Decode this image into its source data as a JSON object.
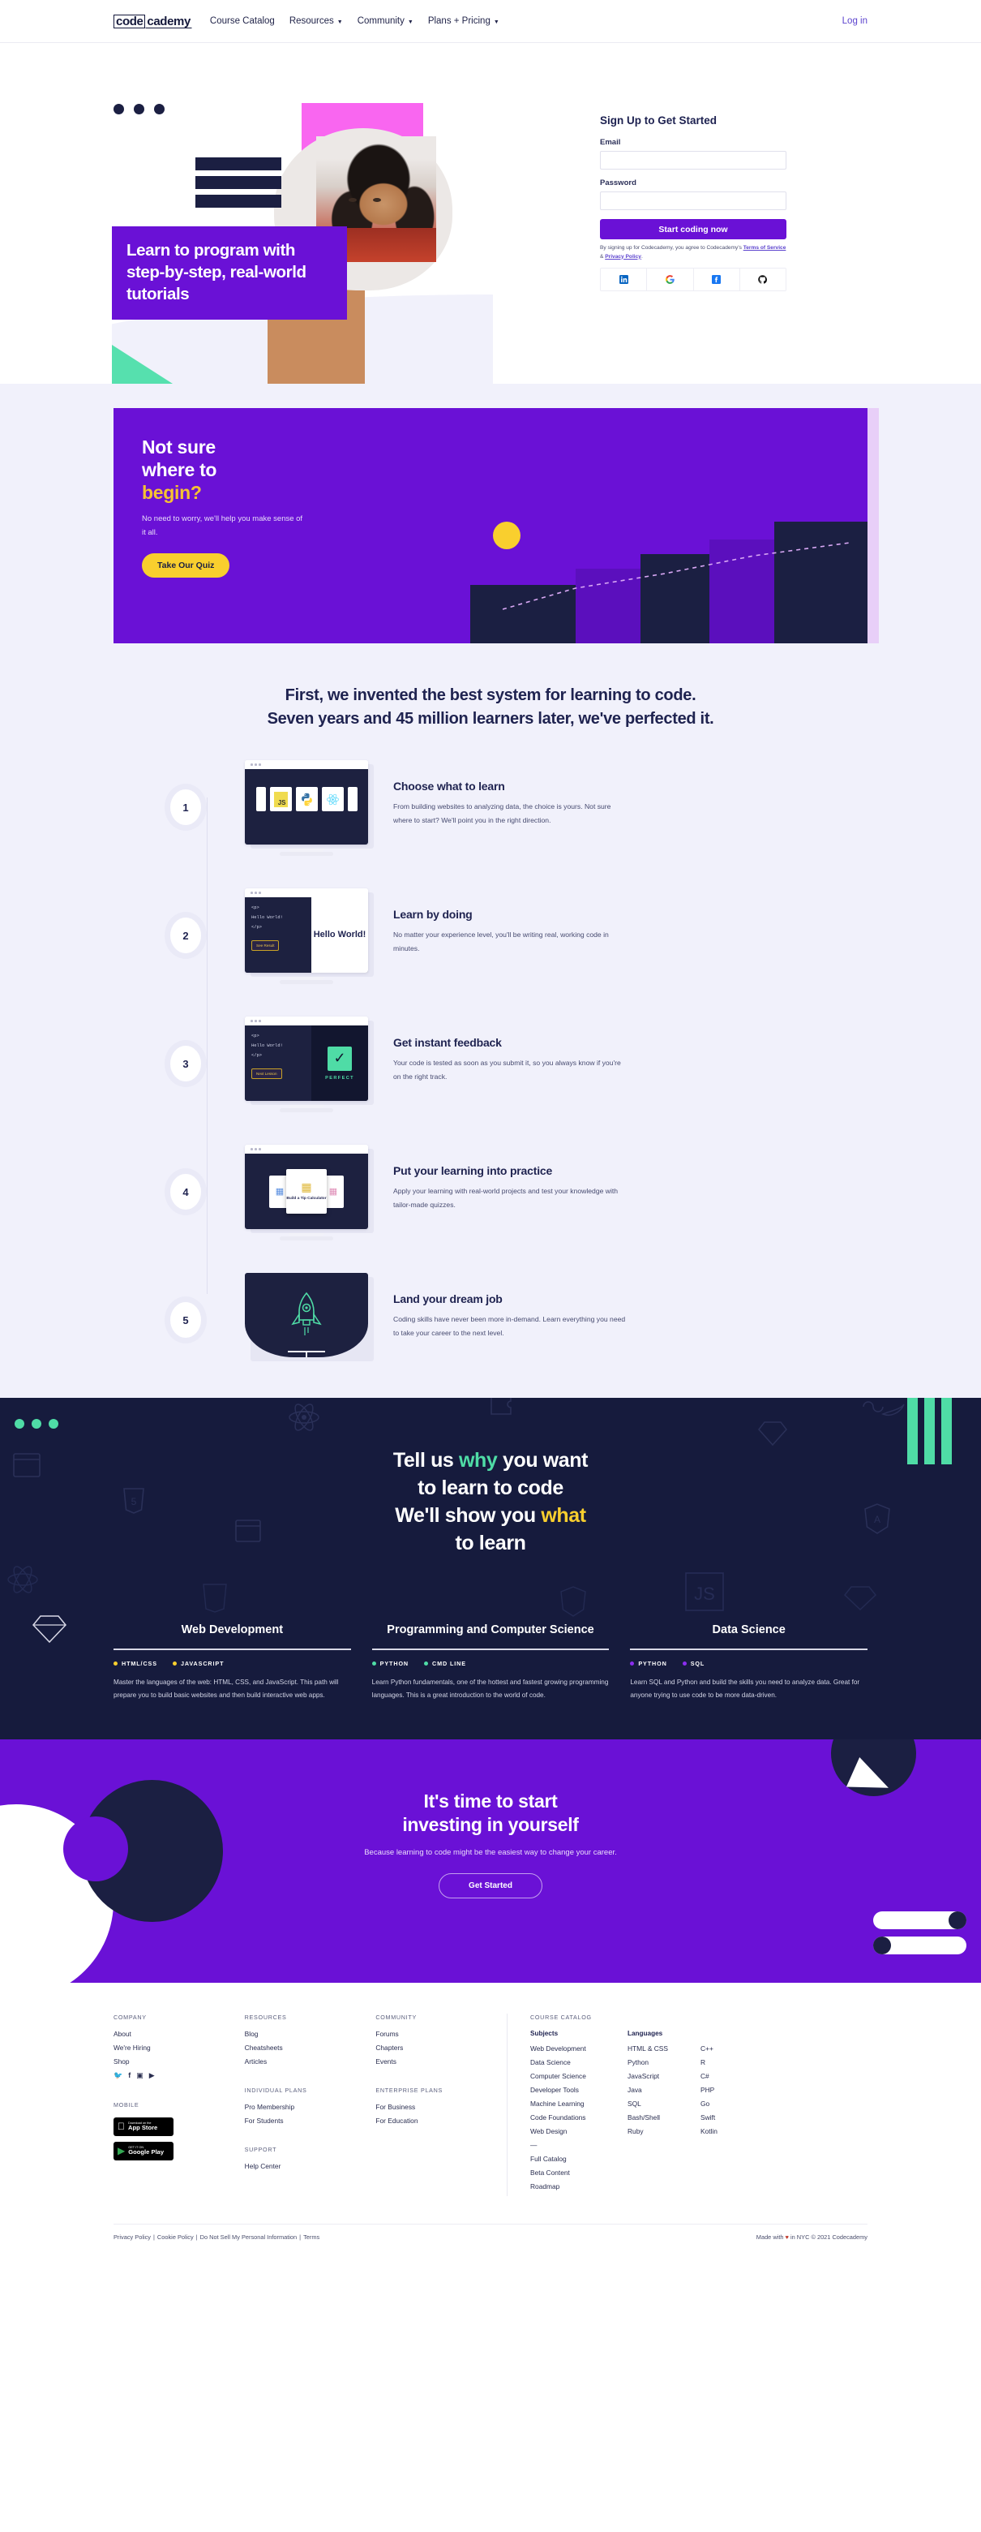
{
  "nav": {
    "logo_part1": "code",
    "logo_part2": "cademy",
    "links": [
      {
        "label": "Course Catalog",
        "caret": false
      },
      {
        "label": "Resources",
        "caret": true
      },
      {
        "label": "Community",
        "caret": true
      },
      {
        "label": "Plans + Pricing",
        "caret": true
      }
    ],
    "login": "Log in"
  },
  "hero": {
    "headline": "Learn to program with step-by-step, real-world tutorials",
    "signup": {
      "title": "Sign Up to Get Started",
      "email_label": "Email",
      "email_value": "",
      "email_placeholder": "",
      "password_label": "Password",
      "password_value": "",
      "password_placeholder": "",
      "submit": "Start coding now",
      "legal_prefix": "By signing up for Codecademy, you agree to Codecademy's ",
      "legal_terms": "Terms of Service",
      "legal_amp": " & ",
      "legal_privacy": "Privacy Policy",
      "legal_suffix": ".",
      "socials": [
        "linkedin-icon",
        "google-icon",
        "facebook-icon",
        "github-icon"
      ]
    }
  },
  "quiz": {
    "line1": "Not sure",
    "line2": "where to",
    "line3": "begin?",
    "sub": "No need to worry, we'll help you make sense of it all.",
    "button": "Take Our Quiz"
  },
  "steps_section": {
    "heading_line1": "First, we invented the best system for learning to code.",
    "heading_line2": "Seven years and 45 million learners later, we've perfected it.",
    "steps": [
      {
        "number": "1",
        "title": "Choose what to learn",
        "body": "From building websites to analyzing data, the choice is yours. Not sure where to start? We'll point you in the right direction.",
        "art": "language-tiles-monitor"
      },
      {
        "number": "2",
        "title": "Learn by doing",
        "body": "No matter your experience level, you'll be writing real, working code in minutes.",
        "art": "code-editor-monitor",
        "code_lines": [
          "<p>",
          "Hello World!",
          "</p>"
        ],
        "code_button": "See Result",
        "preview_text": "Hello World!"
      },
      {
        "number": "3",
        "title": "Get instant feedback",
        "body": "Your code is tested as soon as you submit it, so you always know if you're on the right track.",
        "art": "feedback-monitor",
        "code_lines": [
          "<p>",
          "Hello World!",
          "</p>"
        ],
        "code_button": "Next Lesson",
        "feedback_label": "PERFECT"
      },
      {
        "number": "4",
        "title": "Put your learning into practice",
        "body": "Apply your learning with real-world projects and test your knowledge with tailor-made quizzes.",
        "art": "project-cards-monitor",
        "project_title": "Build a Tip Calculator"
      },
      {
        "number": "5",
        "title": "Land your dream job",
        "body": "Coding skills have never been more in-demand. Learn everything you need to take your career to the next level.",
        "art": "rocket-monitor"
      }
    ]
  },
  "dark_section": {
    "heading": {
      "l1a": "Tell us ",
      "l1b": "why",
      "l1c": " you want",
      "l2": "to learn to code",
      "l3a": "We'll show you ",
      "l3b": "what",
      "l4": "to learn"
    },
    "cards": [
      {
        "title": "Web Development",
        "icon": "diamond-icon",
        "tags": [
          {
            "label": "HTML/CSS",
            "color": "#f9cf2e"
          },
          {
            "label": "JAVASCRIPT",
            "color": "#f9cf2e"
          }
        ],
        "body": "Master the languages of the web: HTML, CSS, and JavaScript. This path will prepare you to build basic websites and then build interactive web apps."
      },
      {
        "title": "Programming and Computer Science",
        "icon": "",
        "tags": [
          {
            "label": "PYTHON",
            "color": "#4fdca6"
          },
          {
            "label": "CMD LINE",
            "color": "#4fdca6"
          }
        ],
        "body": "Learn Python fundamentals, one of the hottest and fastest growing programming languages. This is a great introduction to the world of code."
      },
      {
        "title": "Data Science",
        "icon": "",
        "tags": [
          {
            "label": "PYTHON",
            "color": "#8b2ef0"
          },
          {
            "label": "SQL",
            "color": "#8b2ef0"
          }
        ],
        "body": "Learn SQL and Python and build the skills you need to analyze data. Great for anyone trying to use code to be more data-driven."
      }
    ]
  },
  "cta": {
    "line1": "It's time to start",
    "line2": "investing in yourself",
    "sub": "Because learning to code might be the easiest way to change your career.",
    "button": "Get Started"
  },
  "footer": {
    "columns": [
      {
        "head": "COMPANY",
        "links": [
          "About",
          "We're Hiring",
          "Shop"
        ]
      },
      {
        "head": "RESOURCES",
        "links": [
          "Blog",
          "Cheatsheets",
          "Articles"
        ]
      },
      {
        "head": "COMMUNITY",
        "links": [
          "Forums",
          "Chapters",
          "Events"
        ]
      }
    ],
    "social_icons": [
      "twitter-icon",
      "facebook-icon",
      "instagram-icon",
      "youtube-icon"
    ],
    "mobile_head": "MOBILE",
    "app_store": {
      "small": "Download on the",
      "big": "App Store"
    },
    "google_play": {
      "small": "GET IT ON",
      "big": "Google Play"
    },
    "individual_plans": {
      "head": "INDIVIDUAL PLANS",
      "links": [
        "Pro Membership",
        "For Students"
      ]
    },
    "enterprise_plans": {
      "head": "ENTERPRISE PLANS",
      "links": [
        "For Business",
        "For Education"
      ]
    },
    "support": {
      "head": "SUPPORT",
      "links": [
        "Help Center"
      ]
    },
    "catalog": {
      "head": "COURSE CATALOG",
      "subjects_head": "Subjects",
      "subjects": [
        "Web Development",
        "Data Science",
        "Computer Science",
        "Developer Tools",
        "Machine Learning",
        "Code Foundations",
        "Web Design",
        "—",
        "Full Catalog",
        "Beta Content",
        "Roadmap"
      ],
      "languages_head": "Languages",
      "languages_a": [
        "HTML & CSS",
        "Python",
        "JavaScript",
        "Java",
        "SQL",
        "Bash/Shell",
        "Ruby"
      ],
      "languages_b": [
        "C++",
        "R",
        "C#",
        "PHP",
        "Go",
        "Swift",
        "Kotlin"
      ]
    },
    "bottom": {
      "links": [
        "Privacy Policy",
        "Cookie Policy",
        "Do Not Sell My Personal Information",
        "Terms"
      ],
      "sep": "|",
      "made_prefix": "Made with ",
      "heart": "♥",
      "made_suffix": " in NYC © 2021 Codecademy"
    }
  }
}
